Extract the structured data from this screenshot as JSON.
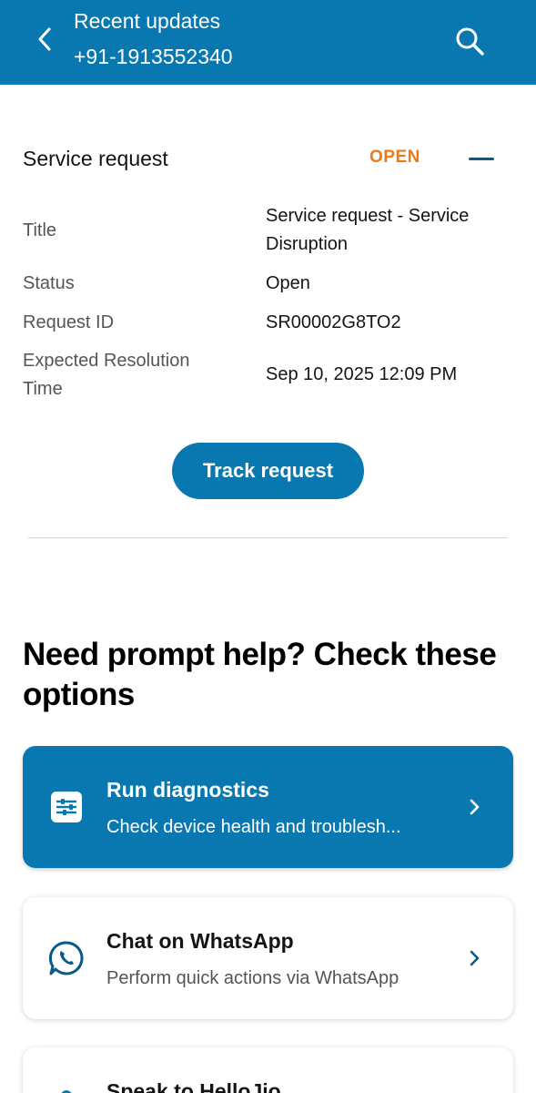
{
  "header": {
    "title": "Recent updates",
    "subtitle": "+91-1913552340",
    "back_icon": "chevron-left-icon",
    "search_icon": "search-icon",
    "background": "#0a78b0"
  },
  "service_request": {
    "heading": "Service request",
    "status_badge": "OPEN",
    "status_color": "#e87a1a",
    "fields": [
      {
        "label": "Title",
        "value": "Service request - Service Disruption"
      },
      {
        "label": "Status",
        "value": "Open"
      },
      {
        "label": "Request ID",
        "value": "SR00002G8TO2"
      },
      {
        "label": "Expected Resolution Time",
        "value": "Sep 10, 2025 12:09 PM"
      }
    ],
    "track_button": "Track request"
  },
  "help": {
    "heading": "Need prompt help? Check these options",
    "options": [
      {
        "title": "Run diagnostics",
        "subtitle": "Check device health and troublesh...",
        "icon": "sliders-icon"
      },
      {
        "title": "Chat on WhatsApp",
        "subtitle": "Perform quick actions via WhatsApp",
        "icon": "whatsapp-icon"
      },
      {
        "title": "Speak to HelloJio",
        "subtitle": "",
        "icon": "microphone-icon"
      }
    ]
  }
}
